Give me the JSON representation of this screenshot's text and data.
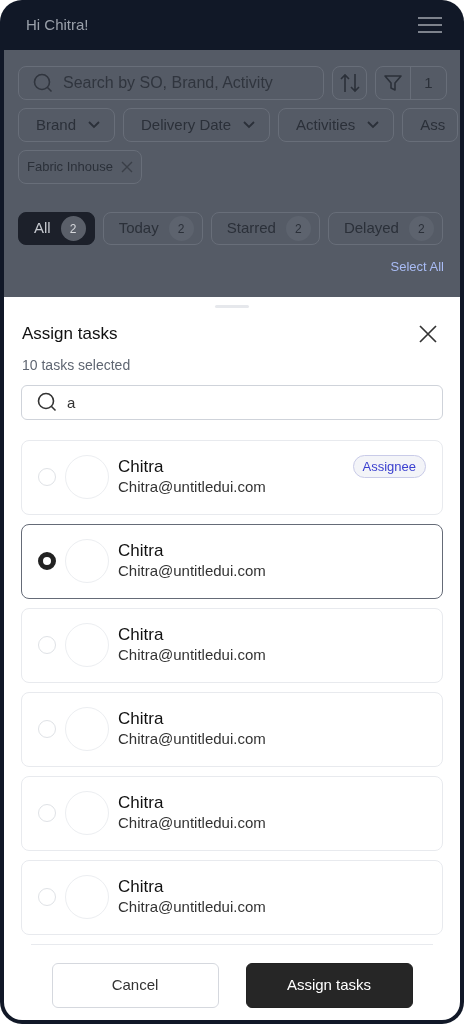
{
  "header": {
    "greeting": "Hi Chitra!"
  },
  "toolbar": {
    "search": {
      "placeholder": "Search by SO, Brand, Activity"
    },
    "filter_count": "1"
  },
  "filters": [
    {
      "label": "Brand"
    },
    {
      "label": "Delivery Date"
    },
    {
      "label": "Activities"
    },
    {
      "label": "Ass"
    }
  ],
  "applied_filters": [
    {
      "label": "Fabric Inhouse"
    }
  ],
  "segments": [
    {
      "label": "All",
      "count": "2",
      "selected": true
    },
    {
      "label": "Today",
      "count": "2",
      "selected": false
    },
    {
      "label": "Starred",
      "count": "2",
      "selected": false
    },
    {
      "label": "Delayed",
      "count": "2",
      "selected": false
    }
  ],
  "select_all": "Select All",
  "sheet": {
    "title": "Assign tasks",
    "subtitle": "10 tasks selected",
    "search": {
      "value": "a"
    },
    "users": [
      {
        "name": "Chitra",
        "email": "Chitra@untitledui.com",
        "selected": false,
        "badge": "Assignee"
      },
      {
        "name": "Chitra",
        "email": "Chitra@untitledui.com",
        "selected": true
      },
      {
        "name": "Chitra",
        "email": "Chitra@untitledui.com",
        "selected": false
      },
      {
        "name": "Chitra",
        "email": "Chitra@untitledui.com",
        "selected": false
      },
      {
        "name": "Chitra",
        "email": "Chitra@untitledui.com",
        "selected": false
      },
      {
        "name": "Chitra",
        "email": "Chitra@untitledui.com",
        "selected": false
      }
    ],
    "buttons": {
      "cancel": "Cancel",
      "confirm": "Assign tasks"
    }
  }
}
